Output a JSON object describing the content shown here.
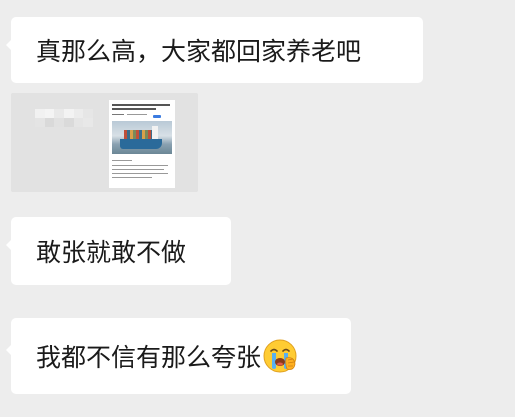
{
  "chat": {
    "messages": [
      {
        "text": "真那么高，大家都回家养老吧"
      },
      {
        "text": "敢张就敢不做"
      },
      {
        "text": "我都不信有那么夸张",
        "emoji": "loudly-crying-face-icon"
      }
    ],
    "shared_card": {
      "thumbnail": "news-article-thumbnail-container-ship",
      "sender_name_blurred": true
    }
  },
  "colors": {
    "background": "#ededed",
    "bubble": "#ffffff",
    "text": "#1a1a1a",
    "card_background": "#e2e2e2"
  }
}
